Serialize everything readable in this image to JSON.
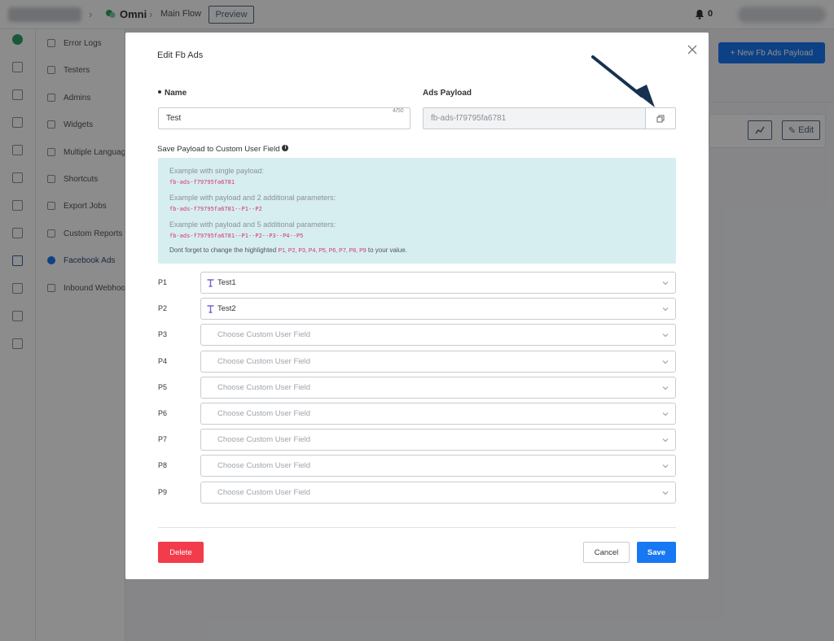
{
  "topbar": {
    "bot_name": "Omni",
    "crumb": "Main Flow",
    "preview_label": "Preview",
    "notification_count": "0"
  },
  "submenu": {
    "items": [
      {
        "label": "Error Logs"
      },
      {
        "label": "Testers"
      },
      {
        "label": "Admins"
      },
      {
        "label": "Widgets"
      },
      {
        "label": "Multiple Languages"
      },
      {
        "label": "Shortcuts"
      },
      {
        "label": "Export Jobs"
      },
      {
        "label": "Custom Reports"
      },
      {
        "label": "Facebook Ads",
        "active": true
      },
      {
        "label": "Inbound Webhooks"
      }
    ]
  },
  "page": {
    "new_button_label": "+ New Fb Ads Payload",
    "edit_label": "Edit"
  },
  "modal": {
    "title": "Edit Fb Ads",
    "name_label": "Name",
    "name_value": "Test",
    "name_count": "4/50",
    "payload_label": "Ads Payload",
    "payload_value": "fb-ads-f79795fa6781",
    "save_payload_label": "Save Payload to Custom User Field",
    "examples": {
      "single_title": "Example with single payload:",
      "single_code": "fb-ads-f79795fa6781",
      "two_title": "Example with payload and 2 additional parameters:",
      "two_code": "fb-ads-f79795fa6781--P1--P2",
      "five_title": "Example with payload and 5 additional parameters:",
      "five_code": "fb-ads-f79795fa6781--P1--P2--P3--P4--P5",
      "note_prefix": "Dont forget to change the highlighted",
      "note_params": "P1, P2, P3, P4, P5, P6, P7, P8, P9",
      "note_suffix": "to your value."
    },
    "params": [
      {
        "label": "P1",
        "value": "Test1",
        "placeholder": ""
      },
      {
        "label": "P2",
        "value": "Test2",
        "placeholder": ""
      },
      {
        "label": "P3",
        "value": "",
        "placeholder": "Choose Custom User Field"
      },
      {
        "label": "P4",
        "value": "",
        "placeholder": "Choose Custom User Field"
      },
      {
        "label": "P5",
        "value": "",
        "placeholder": "Choose Custom User Field"
      },
      {
        "label": "P6",
        "value": "",
        "placeholder": "Choose Custom User Field"
      },
      {
        "label": "P7",
        "value": "",
        "placeholder": "Choose Custom User Field"
      },
      {
        "label": "P8",
        "value": "",
        "placeholder": "Choose Custom User Field"
      },
      {
        "label": "P9",
        "value": "",
        "placeholder": "Choose Custom User Field"
      }
    ],
    "delete_label": "Delete",
    "cancel_label": "Cancel",
    "save_label": "Save"
  },
  "colors": {
    "primary": "#1877f2",
    "danger": "#f23c4c",
    "example_bg": "#d6eef0",
    "code": "#d6336c",
    "annotation_arrow": "#17324f"
  }
}
